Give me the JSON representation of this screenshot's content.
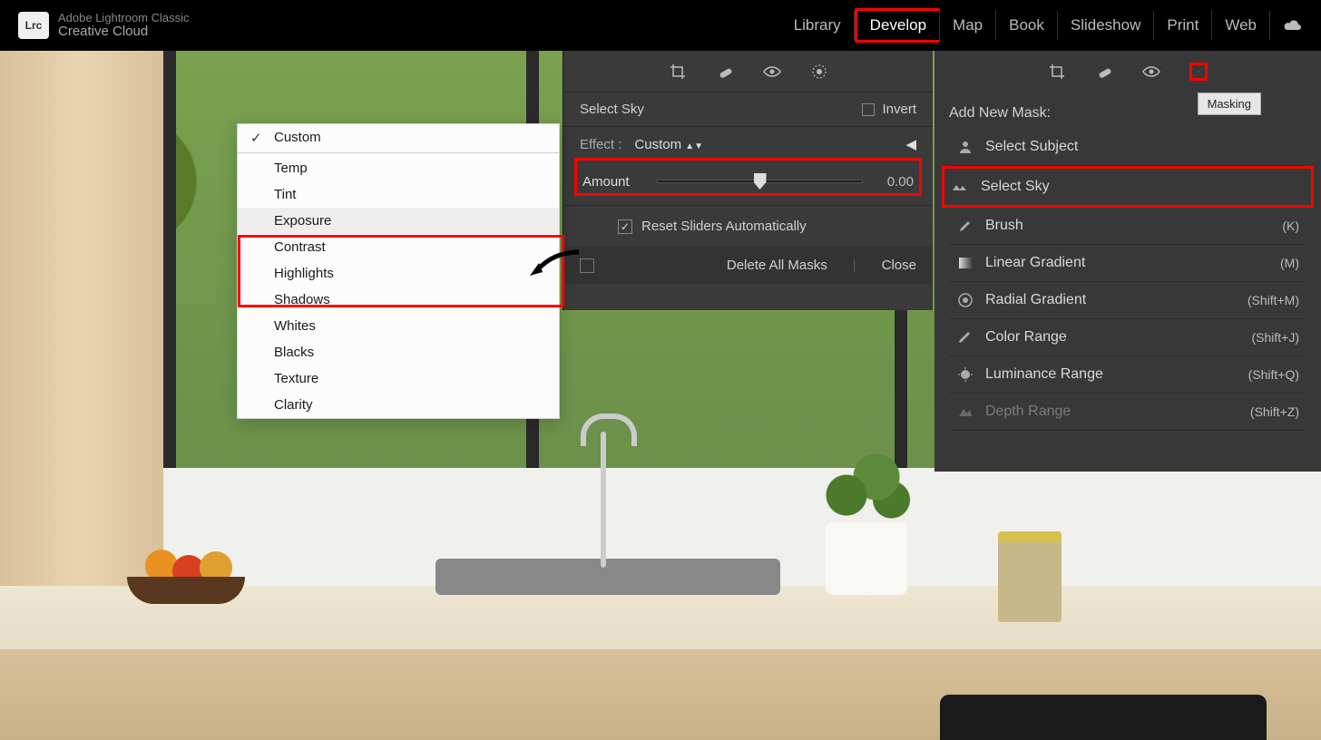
{
  "brand": {
    "line1": "Adobe Lightroom Classic",
    "line2": "Creative Cloud",
    "logo": "Lrc"
  },
  "modules": {
    "library": "Library",
    "develop": "Develop",
    "map": "Map",
    "book": "Book",
    "slideshow": "Slideshow",
    "print": "Print",
    "web": "Web"
  },
  "dropdown": {
    "custom": "Custom",
    "temp": "Temp",
    "tint": "Tint",
    "exposure": "Exposure",
    "contrast": "Contrast",
    "highlights": "Highlights",
    "shadows": "Shadows",
    "whites": "Whites",
    "blacks": "Blacks",
    "texture": "Texture",
    "clarity": "Clarity"
  },
  "effect_panel": {
    "mask_title": "Select Sky",
    "invert": "Invert",
    "effect_label": "Effect :",
    "effect_value": "Custom",
    "amount_label": "Amount",
    "amount_value": "0.00",
    "reset": "Reset Sliders Automatically",
    "delete_all": "Delete All Masks",
    "close": "Close"
  },
  "mask_panel": {
    "tooltip": "Masking",
    "heading": "Add New Mask:",
    "items": {
      "subject": {
        "label": "Select Subject",
        "short": ""
      },
      "sky": {
        "label": "Select Sky",
        "short": ""
      },
      "brush": {
        "label": "Brush",
        "short": "(K)"
      },
      "linear": {
        "label": "Linear Gradient",
        "short": "(M)"
      },
      "radial": {
        "label": "Radial Gradient",
        "short": "(Shift+M)"
      },
      "color": {
        "label": "Color Range",
        "short": "(Shift+J)"
      },
      "luminance": {
        "label": "Luminance Range",
        "short": "(Shift+Q)"
      },
      "depth": {
        "label": "Depth Range",
        "short": "(Shift+Z)"
      }
    }
  }
}
